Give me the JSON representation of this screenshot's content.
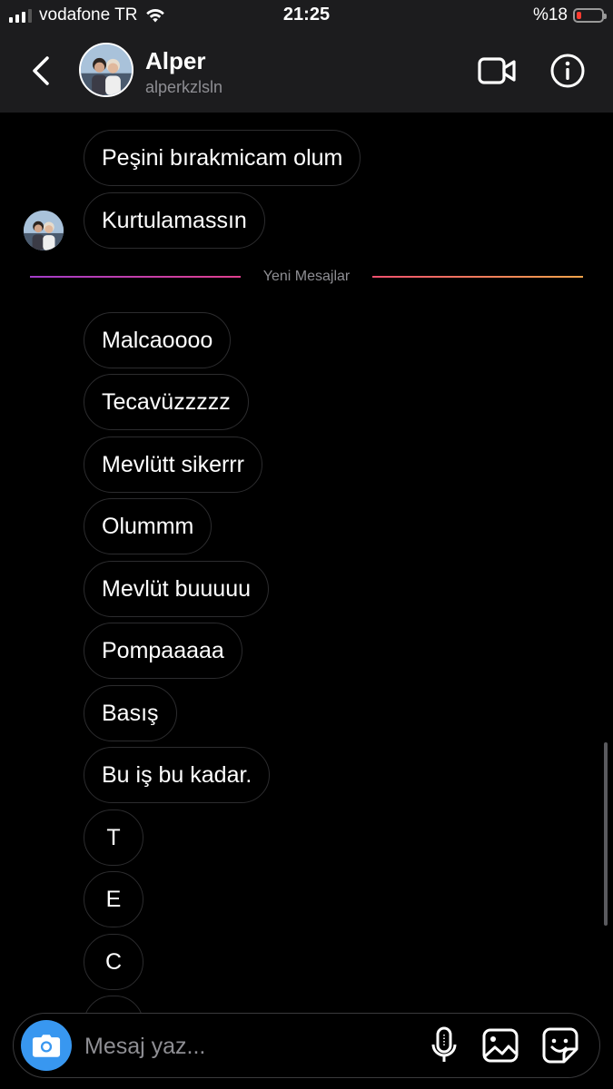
{
  "status_bar": {
    "carrier": "vodafone TR",
    "time": "21:25",
    "battery_text": "%18",
    "battery_level": 0.18,
    "battery_color": "#ff3b30",
    "signal_bars": 3
  },
  "header": {
    "name": "Alper",
    "username": "alperkzlsln",
    "back_icon": "chevron-left-icon",
    "video_icon": "video-camera-icon",
    "info_icon": "info-icon"
  },
  "messages_before": [
    "Peşini bırakmicam olum",
    "Kurtulamassın"
  ],
  "divider": {
    "label": "Yeni Mesajlar"
  },
  "messages_after": [
    "Malcaoooo",
    "Tecavüzzzzz",
    "Mevlütt sikerrr",
    "Olummm",
    "Mevlüt buuuuu",
    "Pompaaaaa",
    "Basış",
    "Bu iş bu kadar.",
    "T",
    "E",
    "C"
  ],
  "composer": {
    "placeholder": "Mesaj yaz...",
    "camera_icon": "camera-icon",
    "mic_icon": "microphone-icon",
    "gallery_icon": "gallery-icon",
    "sticker_icon": "sticker-icon"
  },
  "colors": {
    "accent_blue": "#3897f0",
    "header_bg": "#1c1c1e",
    "bubble_border": "#2c2c2e"
  }
}
